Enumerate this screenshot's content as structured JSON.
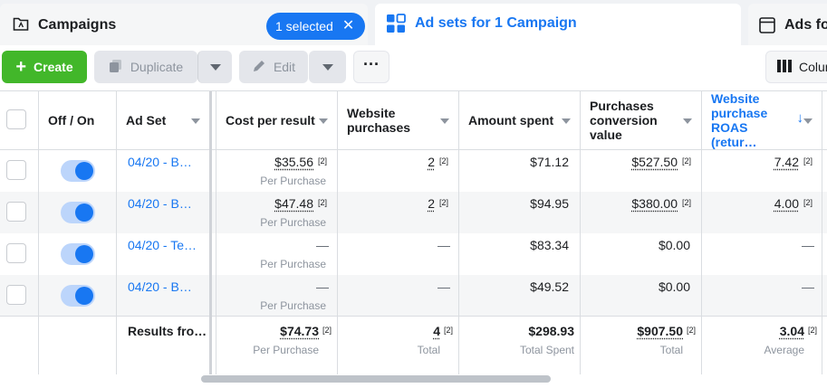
{
  "tabs": {
    "campaigns": {
      "label": "Campaigns",
      "selected_badge": "1 selected"
    },
    "adsets": {
      "label": "Ad sets for 1 Campaign"
    },
    "ads": {
      "label": "Ads fo"
    }
  },
  "toolbar": {
    "create": "Create",
    "duplicate": "Duplicate",
    "edit": "Edit",
    "more": "···",
    "columns": "Colun"
  },
  "colors": {
    "accent": "#1877f2",
    "create_green": "#42b72a"
  },
  "columns": {
    "off_on": "Off / On",
    "ad_set": "Ad Set",
    "cost_per_result": "Cost per result",
    "website_purchases": "Website purchases",
    "amount_spent": "Amount spent",
    "purchases_conversion_value": "Purchases conversion value",
    "website_purchase_roas": "Website purchase ROAS (retur…"
  },
  "rows": [
    {
      "name": "04/20 - B…",
      "cost": "$35.56",
      "cost_sup": "[2]",
      "cost_sub": "Per Purchase",
      "purchases": "2",
      "purchases_sup": "[2]",
      "spent": "$71.12",
      "conv_value": "$527.50",
      "conv_sup": "[2]",
      "roas": "7.42",
      "roas_sup": "[2]",
      "active": true
    },
    {
      "name": "04/20 - B…",
      "cost": "$47.48",
      "cost_sup": "[2]",
      "cost_sub": "Per Purchase",
      "purchases": "2",
      "purchases_sup": "[2]",
      "spent": "$94.95",
      "conv_value": "$380.00",
      "conv_sup": "[2]",
      "roas": "4.00",
      "roas_sup": "[2]",
      "active": true
    },
    {
      "name": "04/20 - Te…",
      "cost": "—",
      "cost_sub": "Per Purchase",
      "purchases": "—",
      "spent": "$83.34",
      "conv_value": "$0.00",
      "roas": "—",
      "active": true
    },
    {
      "name": "04/20 - B…",
      "cost": "—",
      "cost_sub": "Per Purchase",
      "purchases": "—",
      "spent": "$49.52",
      "conv_value": "$0.00",
      "roas": "—",
      "active": true
    }
  ],
  "totals": {
    "label": "Results fro…",
    "cost": "$74.73",
    "cost_sup": "[2]",
    "cost_sub": "Per Purchase",
    "purchases": "4",
    "purchases_sup": "[2]",
    "purchases_sub": "Total",
    "spent": "$298.93",
    "spent_sub": "Total Spent",
    "conv_value": "$907.50",
    "conv_sup": "[2]",
    "conv_sub": "Total",
    "roas": "3.04",
    "roas_sup": "[2]",
    "roas_sub": "Average"
  }
}
